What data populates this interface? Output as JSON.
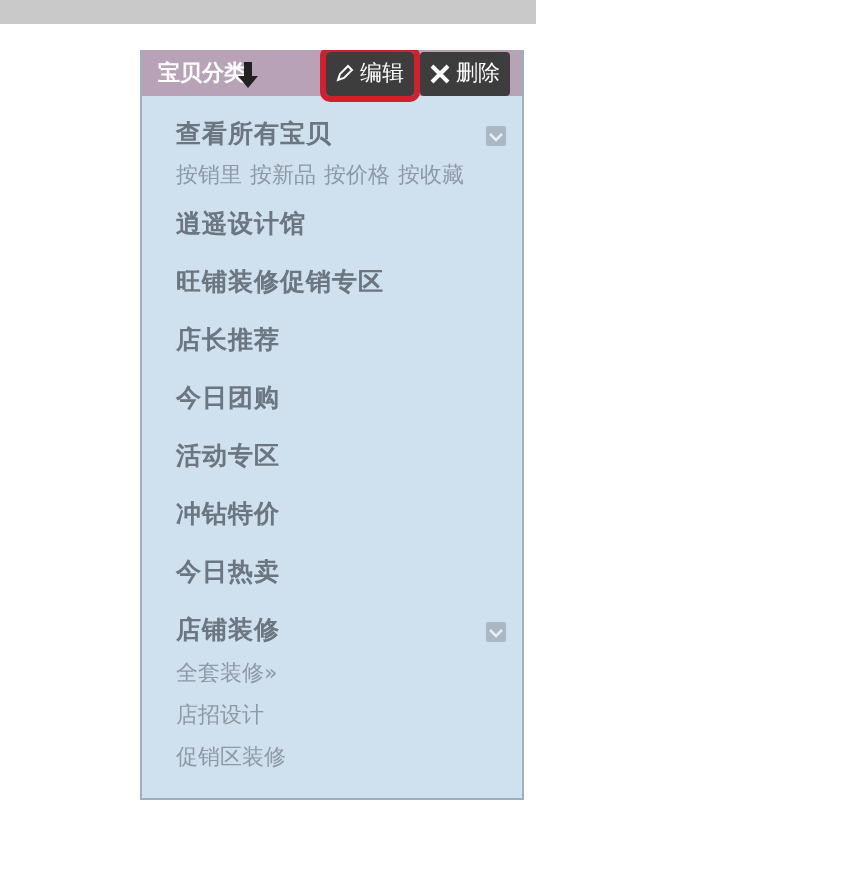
{
  "panel": {
    "title": "宝贝分类",
    "buttons": [
      {
        "kind": "edit",
        "label": "编辑",
        "highlighted": true
      },
      {
        "kind": "delete",
        "label": "删除",
        "highlighted": false
      }
    ]
  },
  "categories": [
    {
      "name": "查看所有宝贝",
      "sort_links": [
        "按销里",
        "按新品",
        "按价格",
        "按收藏"
      ]
    },
    {
      "name": "逍遥设计馆"
    },
    {
      "name": "旺铺装修促销专区"
    },
    {
      "name": "店长推荐"
    },
    {
      "name": "今日团购"
    },
    {
      "name": "活动专区"
    },
    {
      "name": "冲钻特价"
    },
    {
      "name": "今日热卖"
    },
    {
      "name": "店铺装修",
      "children": [
        "全套装修»",
        "店招设计",
        "促销区装修"
      ]
    }
  ]
}
